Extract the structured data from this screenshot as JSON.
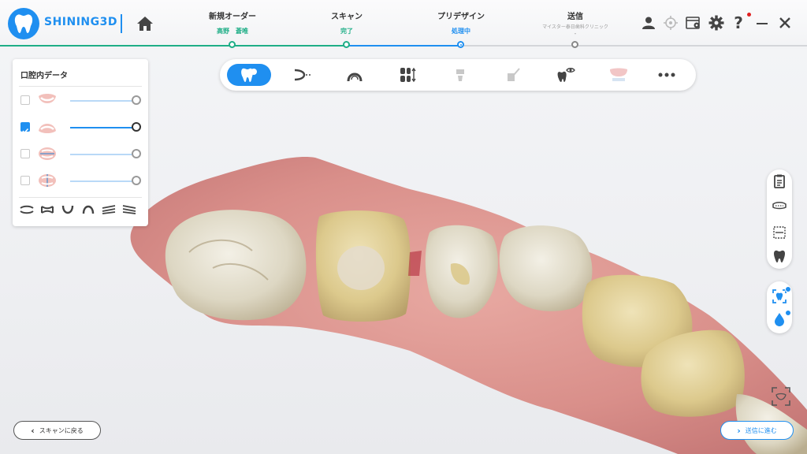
{
  "app": {
    "brand": "SHINING3D"
  },
  "steps": [
    {
      "title": "新規オーダー",
      "status": "高野　蒼唯"
    },
    {
      "title": "スキャン",
      "status": "完了"
    },
    {
      "title": "プリデザイン",
      "status": "処理中"
    },
    {
      "title": "送信",
      "status": "マイスター泰日歯科クリニック",
      "sub": "-"
    }
  ],
  "panel": {
    "title": "口腔内データ",
    "rows": [
      {
        "checked": false,
        "value": 1.0
      },
      {
        "checked": true,
        "value": 1.0
      },
      {
        "checked": false,
        "value": 1.0
      },
      {
        "checked": false,
        "value": 1.0
      }
    ]
  },
  "toolbar": {
    "active_index": 0
  },
  "buttons": {
    "back": "スキャンに戻る",
    "next": "送信に進む"
  },
  "colors": {
    "accent": "#1f8ff0",
    "done": "#1fae87",
    "notify": "#e02020"
  }
}
